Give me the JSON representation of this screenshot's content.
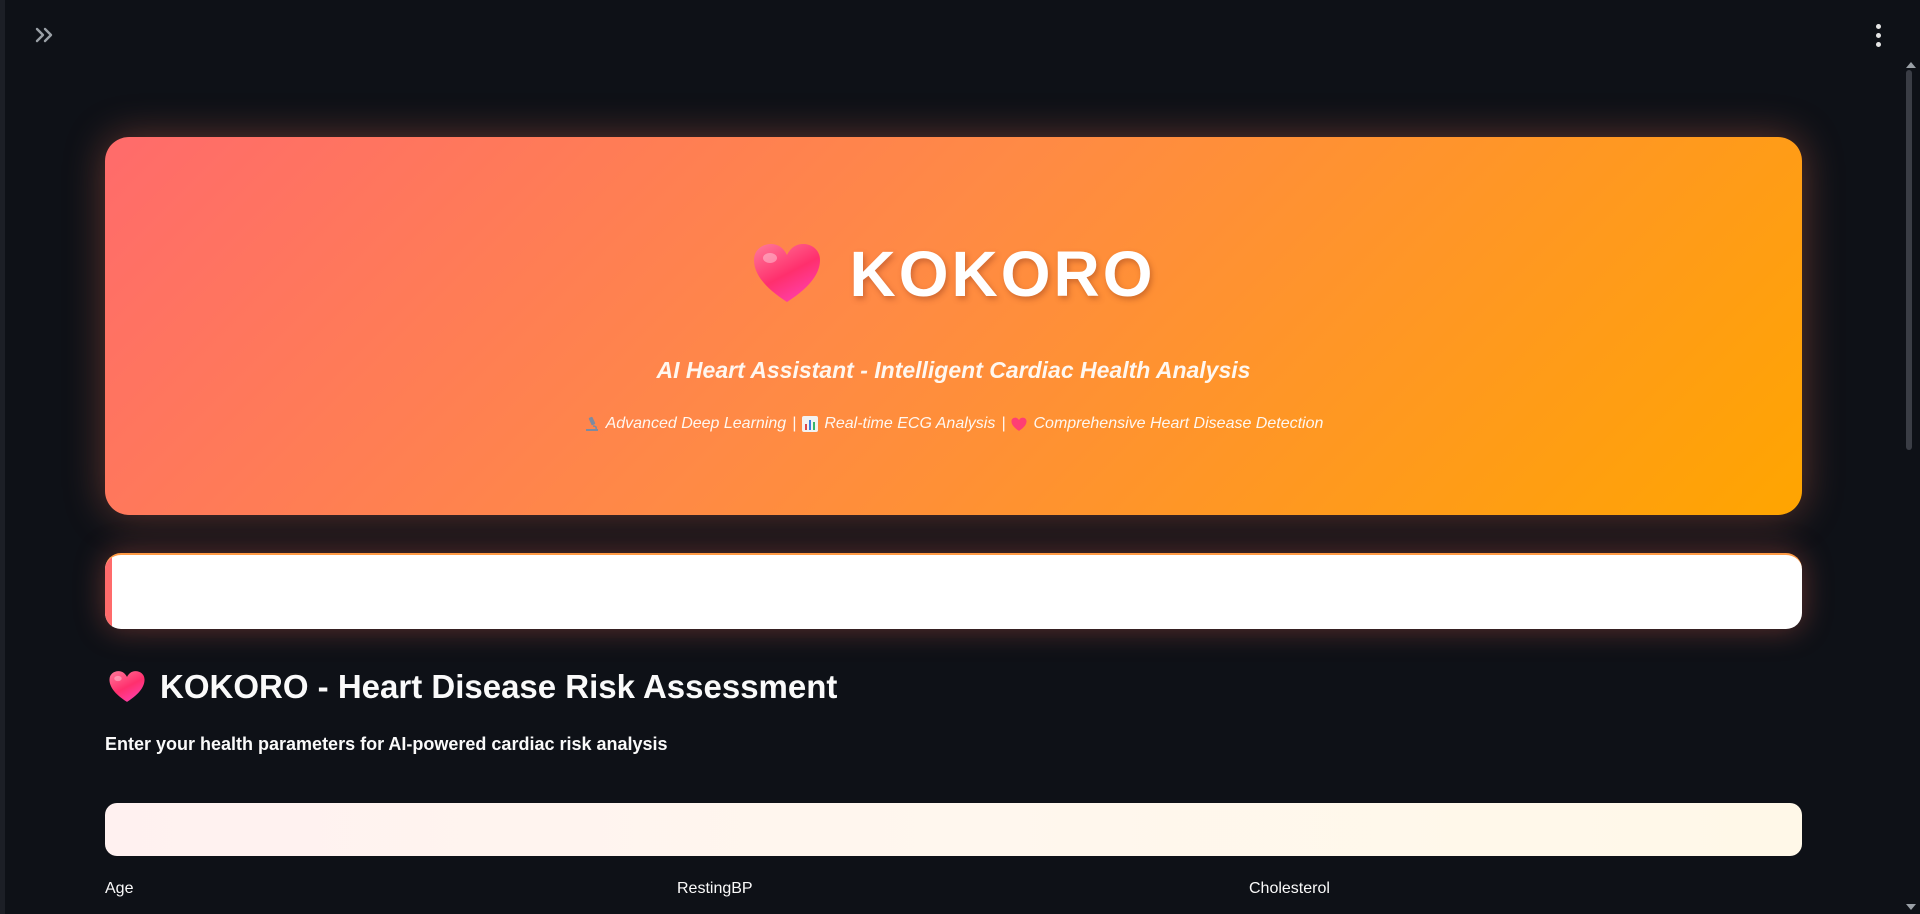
{
  "hero": {
    "title": "KOKORO",
    "subtitle": "AI Heart Assistant - Intelligent Cardiac Health Analysis",
    "features": [
      {
        "icon": "microscope-icon",
        "label": "Advanced Deep Learning"
      },
      {
        "icon": "bar-chart-icon",
        "label": "Real-time ECG Analysis"
      },
      {
        "icon": "heart-icon",
        "label": "Comprehensive Heart Disease Detection"
      }
    ],
    "separator": "|",
    "gradient_colors": [
      "#ff6b6b",
      "#ffa500"
    ]
  },
  "assessment": {
    "title": "KOKORO - Heart Disease Risk Assessment",
    "subtitle": "Enter your health parameters for AI-powered cardiac risk analysis"
  },
  "fields": {
    "age_label": "Age",
    "resting_bp_label": "RestingBP",
    "cholesterol_label": "Cholesterol"
  },
  "colors": {
    "background": "#0e1117",
    "accent": "#ff6b6b",
    "text": "#fafafa"
  }
}
